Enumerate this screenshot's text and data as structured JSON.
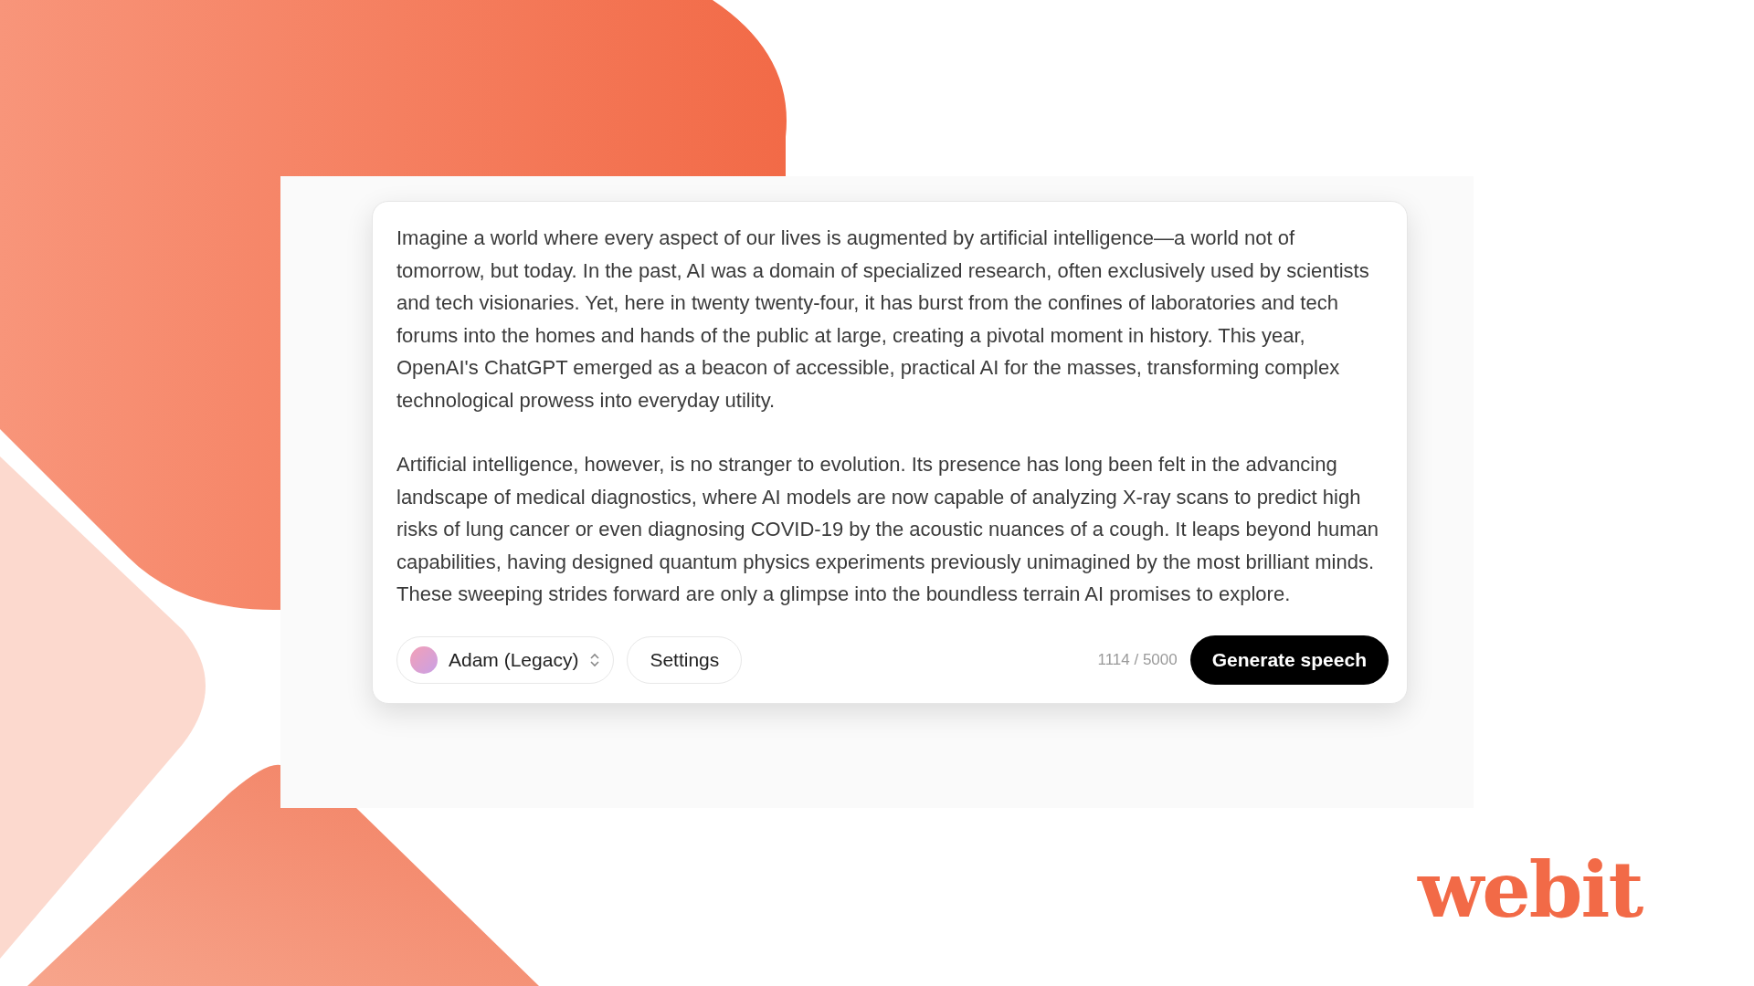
{
  "editor": {
    "paragraphs": [
      "Imagine a world where every aspect of our lives is augmented by artificial intelligence—a world not of tomorrow, but today. In the past, AI was a domain of specialized research, often exclusively used by scientists and tech visionaries. Yet, here in twenty twenty-four, it has burst from the confines of laboratories and tech forums into the homes and hands of the public at large, creating a pivotal moment in history. This year, OpenAI's ChatGPT emerged as a beacon of accessible, practical AI for the masses, transforming complex technological prowess into everyday utility.",
      "Artificial intelligence, however, is no stranger to evolution. Its presence has long been felt in the advancing landscape of medical diagnostics, where AI models are now capable of analyzing X-ray scans to predict high risks of lung cancer or even diagnosing COVID-19 by the acoustic nuances of a cough. It leaps beyond human capabilities, having designed quantum physics experiments previously unimagined by the most brilliant minds. These sweeping strides forward are only a glimpse into the boundless terrain AI promises to explore."
    ],
    "voice": "Adam (Legacy)",
    "settings_button": "Settings",
    "char_count": "1114 / 5000",
    "generate_button": "Generate speech"
  },
  "logo": "webit"
}
